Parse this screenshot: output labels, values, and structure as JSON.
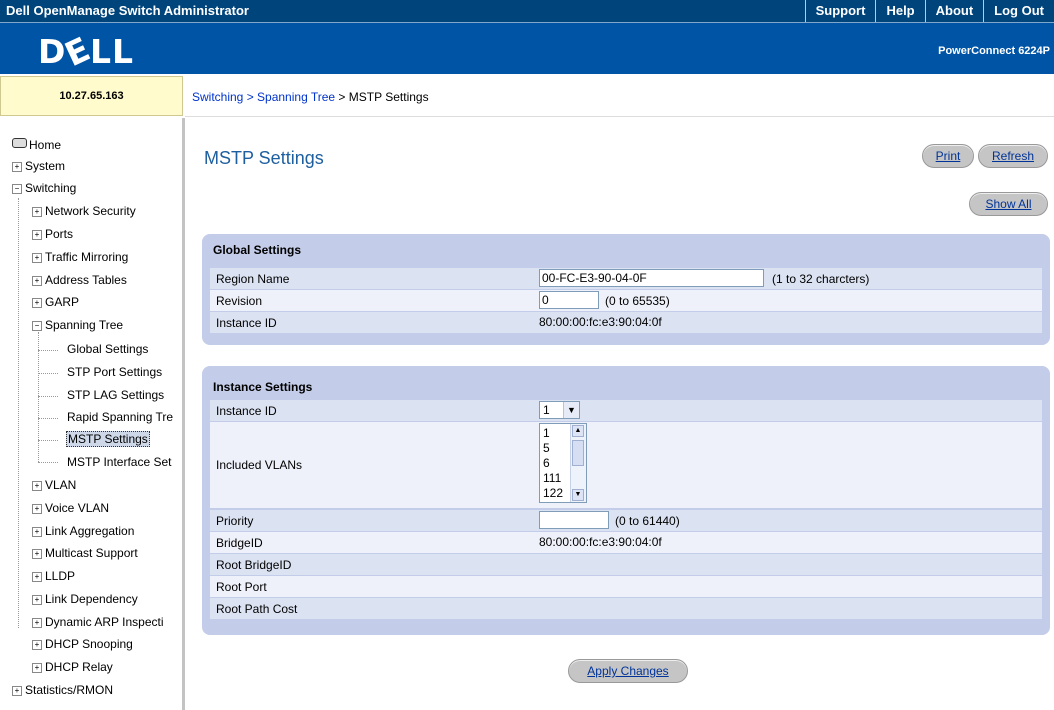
{
  "header": {
    "app_title": "Dell OpenManage Switch Administrator",
    "links": [
      "Support",
      "Help",
      "About",
      "Log Out"
    ],
    "logo_text": "D&LL",
    "product_name": "PowerConnect 6224P",
    "ip_address": "10.27.65.163"
  },
  "breadcrumb": {
    "link": "Switching > Spanning Tree",
    "separator": " > ",
    "current": "MSTP Settings"
  },
  "sidebar": {
    "items": [
      {
        "label": "Home"
      },
      {
        "label": "System"
      },
      {
        "label": "Switching"
      },
      {
        "label": "Network Security"
      },
      {
        "label": "Ports"
      },
      {
        "label": "Traffic Mirroring"
      },
      {
        "label": "Address Tables"
      },
      {
        "label": "GARP"
      },
      {
        "label": "Spanning Tree"
      },
      {
        "label": "Global Settings"
      },
      {
        "label": "STP Port Settings"
      },
      {
        "label": "STP LAG Settings"
      },
      {
        "label": "Rapid Spanning Tre"
      },
      {
        "label": "MSTP Settings"
      },
      {
        "label": "MSTP Interface Set"
      },
      {
        "label": "VLAN"
      },
      {
        "label": "Voice VLAN"
      },
      {
        "label": "Link Aggregation"
      },
      {
        "label": "Multicast Support"
      },
      {
        "label": "LLDP"
      },
      {
        "label": "Link Dependency"
      },
      {
        "label": "Dynamic ARP Inspecti"
      },
      {
        "label": "DHCP Snooping"
      },
      {
        "label": "DHCP Relay"
      },
      {
        "label": "Statistics/RMON"
      }
    ]
  },
  "main": {
    "title": "MSTP Settings",
    "buttons": {
      "print": "Print",
      "refresh": "Refresh",
      "show_all": "Show All",
      "apply": "Apply Changes"
    },
    "global": {
      "title": "Global Settings",
      "region_name_label": "Region Name",
      "region_name_value": "00-FC-E3-90-04-0F",
      "region_name_hint": "(1 to 32 charcters)",
      "revision_label": "Revision",
      "revision_value": "0",
      "revision_hint": "(0 to 65535)",
      "instance_id_label": "Instance ID",
      "instance_id_value": "80:00:00:fc:e3:90:04:0f"
    },
    "instance": {
      "title": "Instance Settings",
      "instance_id_label": "Instance ID",
      "instance_id_selected": "1",
      "included_vlans_label": "Included VLANs",
      "vlans": [
        "1",
        "5",
        "6",
        "111",
        "122"
      ],
      "priority_label": "Priority",
      "priority_value": "",
      "priority_hint": "(0 to 61440)",
      "bridge_id_label": "BridgeID",
      "bridge_id_value": "80:00:00:fc:e3:90:04:0f",
      "root_bridge_id_label": "Root BridgeID",
      "root_port_label": "Root Port",
      "root_path_cost_label": "Root Path Cost"
    }
  }
}
